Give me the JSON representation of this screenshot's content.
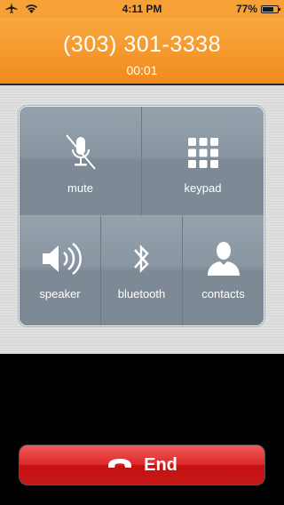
{
  "status_bar": {
    "time": "4:11 PM",
    "battery_text": "77%",
    "battery_level": 0.77,
    "icons": [
      "airplane-icon",
      "wifi-icon",
      "battery-icon"
    ]
  },
  "call": {
    "number": "(303) 301-3338",
    "timer": "00:01"
  },
  "controls": {
    "mute_label": "mute",
    "keypad_label": "keypad",
    "speaker_label": "speaker",
    "bluetooth_label": "bluetooth",
    "contacts_label": "contacts"
  },
  "end_button": {
    "label": "End"
  },
  "colors": {
    "header": "#f39a2e",
    "panel": "#7c8a96",
    "end": "#d52020"
  }
}
